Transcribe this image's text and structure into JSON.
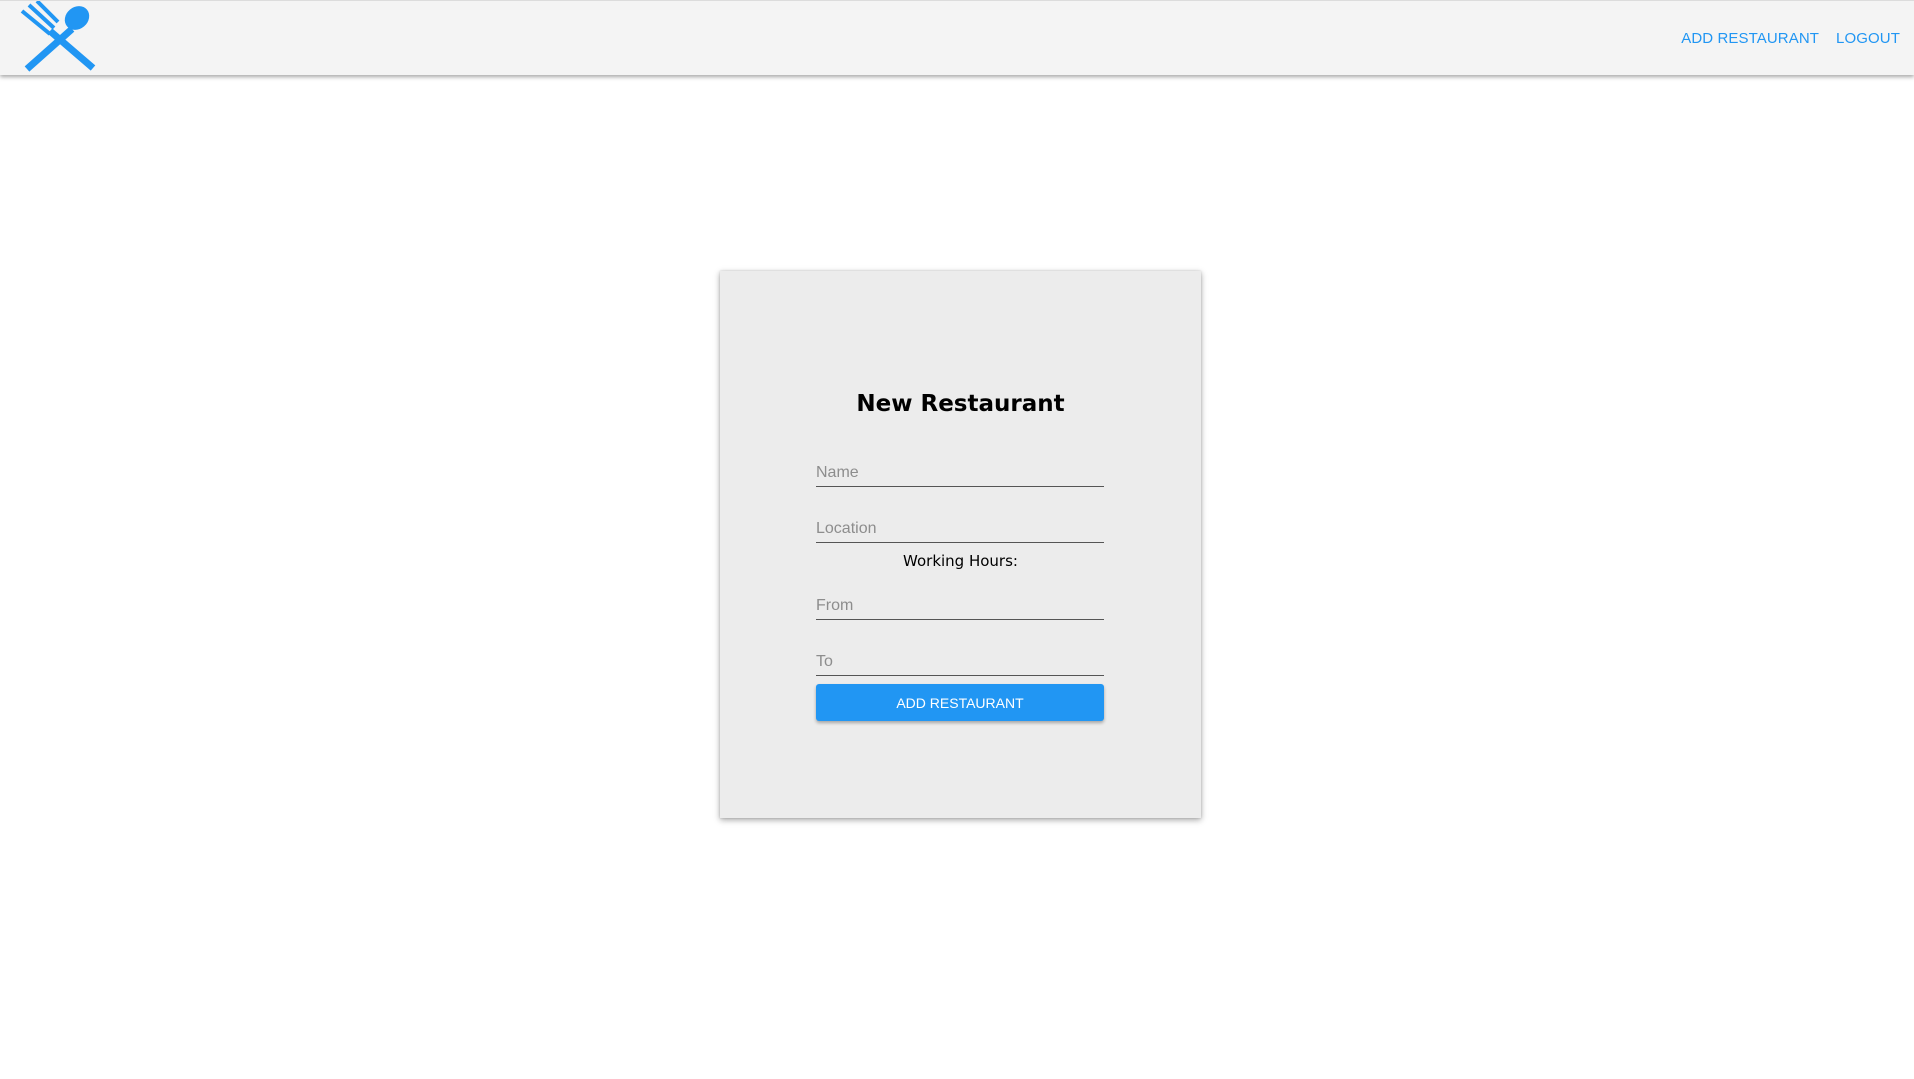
{
  "header": {
    "logo_icon": "fork-spoon-icon",
    "brand_color": "#2196f3",
    "nav": [
      {
        "label": "ADD RESTAURANT"
      },
      {
        "label": "LOGOUT"
      }
    ]
  },
  "form": {
    "title": "New Restaurant",
    "fields": {
      "name": {
        "placeholder": "Name",
        "value": ""
      },
      "location": {
        "placeholder": "Location",
        "value": ""
      },
      "from": {
        "placeholder": "From",
        "value": ""
      },
      "to": {
        "placeholder": "To",
        "value": ""
      }
    },
    "hours_label": "Working Hours:",
    "submit_label": "ADD RESTAURANT"
  }
}
